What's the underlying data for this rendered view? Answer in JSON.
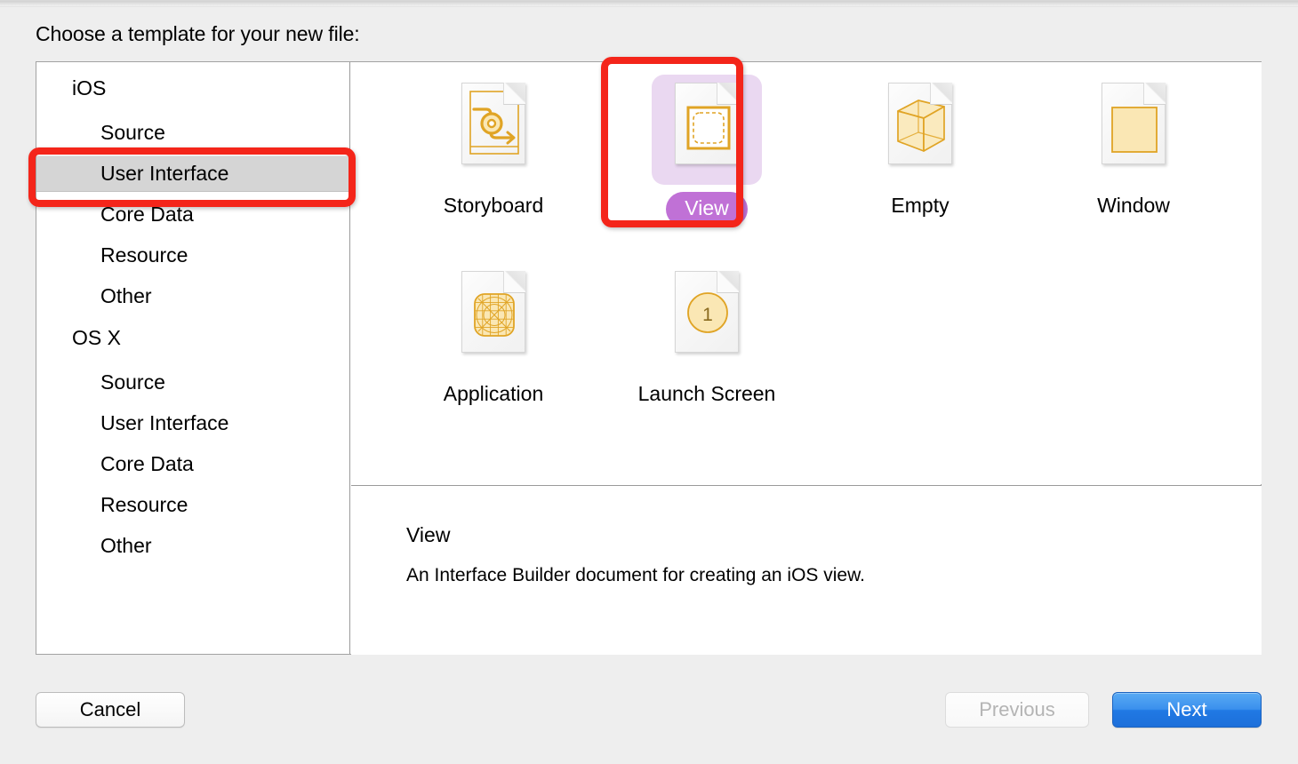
{
  "dialog": {
    "prompt": "Choose a template for your new file:"
  },
  "sidebar": {
    "groups": [
      {
        "label": "iOS",
        "items": [
          {
            "label": "Source",
            "selected": false
          },
          {
            "label": "User Interface",
            "selected": true
          },
          {
            "label": "Core Data",
            "selected": false
          },
          {
            "label": "Resource",
            "selected": false
          },
          {
            "label": "Other",
            "selected": false
          }
        ]
      },
      {
        "label": "OS X",
        "items": [
          {
            "label": "Source",
            "selected": false
          },
          {
            "label": "User Interface",
            "selected": false
          },
          {
            "label": "Core Data",
            "selected": false
          },
          {
            "label": "Resource",
            "selected": false
          },
          {
            "label": "Other",
            "selected": false
          }
        ]
      }
    ],
    "selected_item": "User Interface",
    "selected_row_bg": "#d5d5d5"
  },
  "templates": [
    {
      "label": "Storyboard",
      "icon": "storyboard-document-icon",
      "selected": false
    },
    {
      "label": "View",
      "icon": "view-document-icon",
      "selected": true
    },
    {
      "label": "Empty",
      "icon": "empty-cube-document-icon",
      "selected": false
    },
    {
      "label": "Window",
      "icon": "window-document-icon",
      "selected": false
    },
    {
      "label": "Application",
      "icon": "application-grid-document-icon",
      "selected": false
    },
    {
      "label": "Launch Screen",
      "icon": "launch-screen-document-icon",
      "selected": false
    }
  ],
  "description": {
    "title": "View",
    "body": "An Interface Builder document for creating an iOS view."
  },
  "buttons": {
    "cancel": "Cancel",
    "previous": "Previous",
    "next": "Next",
    "previous_enabled": false,
    "next_is_default": true
  },
  "colors": {
    "accent_blue": "#2079e4",
    "selection_pill": "#c071d6",
    "selection_bg": "#ead8f1",
    "icon_amber": "#e0a425",
    "icon_amber_fill": "#fae7b4",
    "annotation_red": "#f4251a",
    "window_bg": "#eeeeee",
    "panel_bg": "#ffffff"
  },
  "annotations": [
    {
      "name": "sidebar-user-interface-highlight",
      "target": "User Interface"
    },
    {
      "name": "view-template-highlight",
      "target": "View"
    }
  ]
}
